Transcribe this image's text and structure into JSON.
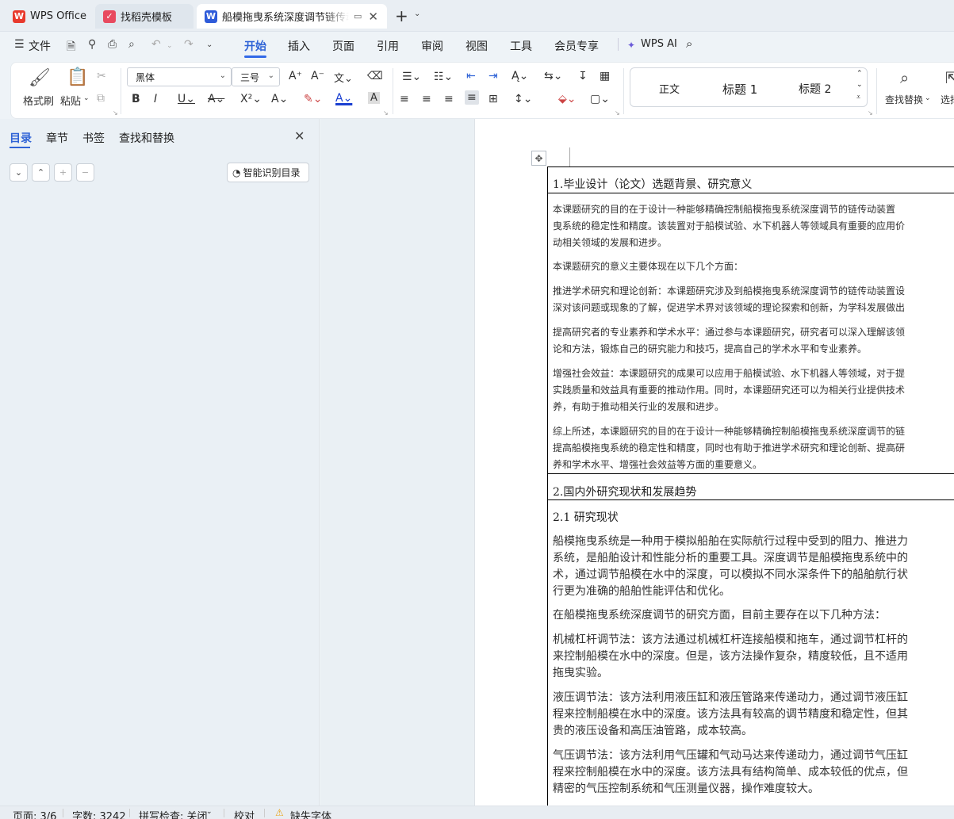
{
  "tabs": [
    {
      "label": "WPS Office"
    },
    {
      "label": "找稻壳模板"
    },
    {
      "label": "船模拖曳系统深度调节链传动装"
    }
  ],
  "menu": {
    "file": "文件",
    "items": [
      "开始",
      "插入",
      "页面",
      "引用",
      "审阅",
      "视图",
      "工具",
      "会员专享"
    ],
    "wps_ai": "WPS AI"
  },
  "ribbon": {
    "format_painter": "格式刷",
    "paste": "粘贴",
    "font_name": "黑体",
    "font_size": "三号",
    "styles": [
      "正文",
      "标题 1",
      "标题 2"
    ],
    "find_replace": "查找替换",
    "select": "选择"
  },
  "nav": {
    "tabs": [
      "目录",
      "章节",
      "书签",
      "查找和替换"
    ],
    "smart_toc": "智能识别目录"
  },
  "document": {
    "h1": "1.毕业设计（论文）选题背景、研究意义",
    "p1": [
      "本课题研究的目的在于设计一种能够精确控制船模拖曳系统深度调节的链传动装置",
      "曳系统的稳定性和精度。该装置对于船模试验、水下机器人等领域具有重要的应用价",
      "动相关领域的发展和进步。"
    ],
    "p2": [
      "本课题研究的意义主要体现在以下几个方面："
    ],
    "p3": [
      "推进学术研究和理论创新：本课题研究涉及到船模拖曳系统深度调节的链传动装置设",
      "深对该问题或现象的了解，促进学术界对该领域的理论探索和创新，为学科发展做出"
    ],
    "p4": [
      "提高研究者的专业素养和学术水平：通过参与本课题研究，研究者可以深入理解该领",
      "论和方法，锻炼自己的研究能力和技巧，提高自己的学术水平和专业素养。"
    ],
    "p5": [
      "增强社会效益：本课题研究的成果可以应用于船模试验、水下机器人等领域，对于提",
      "实践质量和效益具有重要的推动作用。同时，本课题研究还可以为相关行业提供技术",
      "养，有助于推动相关行业的发展和进步。"
    ],
    "p6": [
      "综上所述，本课题研究的目的在于设计一种能够精确控制船模拖曳系统深度调节的链",
      "提高船模拖曳系统的稳定性和精度，同时也有助于推进学术研究和理论创新、提高研",
      "养和学术水平、增强社会效益等方面的重要意义。"
    ],
    "h2": "2.国内外研究现状和发展趋势",
    "h21": "2.1 研究现状",
    "q1": [
      "船模拖曳系统是一种用于模拟船舶在实际航行过程中受到的阻力、推进力",
      "系统，是船舶设计和性能分析的重要工具。深度调节是船模拖曳系统中的",
      "术，通过调节船模在水中的深度，可以模拟不同水深条件下的船舶航行状",
      "行更为准确的船舶性能评估和优化。"
    ],
    "q2": [
      "在船模拖曳系统深度调节的研究方面，目前主要存在以下几种方法："
    ],
    "q3": [
      "机械杠杆调节法：该方法通过机械杠杆连接船模和拖车，通过调节杠杆的",
      "来控制船模在水中的深度。但是，该方法操作复杂，精度较低，且不适用",
      "拖曳实验。"
    ],
    "q4": [
      "液压调节法：该方法利用液压缸和液压管路来传递动力，通过调节液压缸",
      "程来控制船模在水中的深度。该方法具有较高的调节精度和稳定性，但其",
      "贵的液压设备和高压油管路，成本较高。"
    ],
    "q5": [
      "气压调节法：该方法利用气压罐和气动马达来传递动力，通过调节气压缸",
      "程来控制船模在水中的深度。该方法具有结构简单、成本较低的优点，但",
      "精密的气压控制系统和气压测量仪器，操作难度较大。"
    ]
  },
  "status": {
    "page": "页面: 3/6",
    "words": "字数: 3242",
    "spell": "拼写检查: 关闭",
    "proof": "校对",
    "missing_font": "缺失字体"
  },
  "colors": {
    "accent": "#3369e7",
    "wps_red": "#e8392c",
    "doc_blue": "#2e5bd9"
  }
}
